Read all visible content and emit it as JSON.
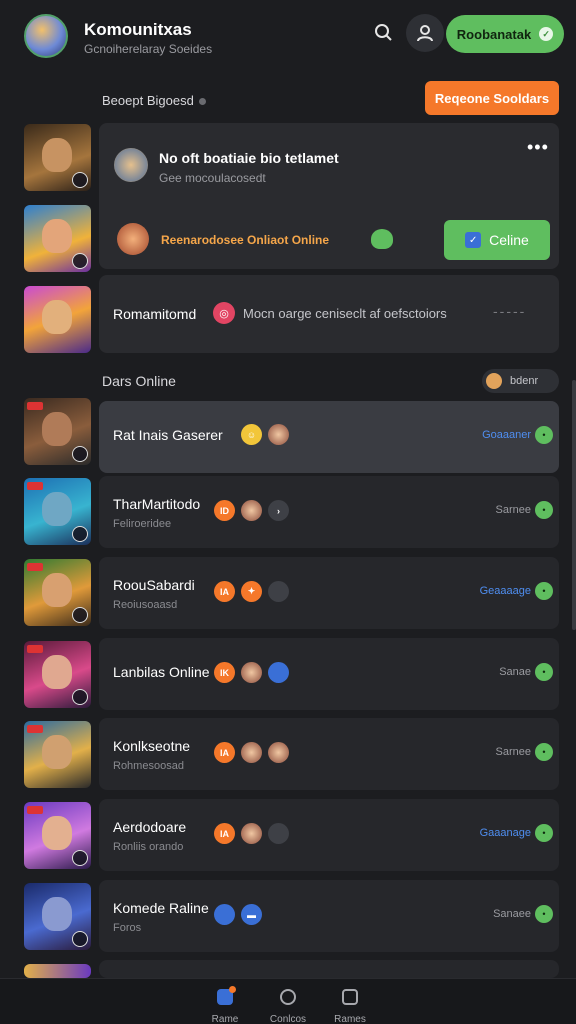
{
  "header": {
    "title": "Komounitxas",
    "subtitle": "Gcnoiherelaray Soeides",
    "cta_label": "Roobanatak"
  },
  "section1": {
    "label": "Beoept Bigoesd",
    "button_label": "Reqeone Sooldars"
  },
  "featured": {
    "title": "No oft boatiaie bio tetlamet",
    "subtitle": "Gee mocoulacosedt",
    "row_text": "Reenarodosee Onliaot Online",
    "online_button": "Celine"
  },
  "recommend": {
    "title": "Romamitomd",
    "text": "Mocn oarge ceniseclt af oefsctoiors",
    "dashes": "-----"
  },
  "section2": {
    "label": "Dars Online",
    "pill_label": "bdenr"
  },
  "rows": [
    {
      "name": "Rat Inais Gaserer",
      "sub": "",
      "badge": "",
      "status": "Goaaaner"
    },
    {
      "name": "TharMartitodo",
      "sub": "Feliroeridee",
      "badge": "ID",
      "status": "Sarnee"
    },
    {
      "name": "RoouSabardi",
      "sub": "Reoiusoaasd",
      "badge": "IA",
      "status": "Geaaaage"
    },
    {
      "name": "Lanbilas Online",
      "sub": "",
      "badge": "IK",
      "status": "Sanae"
    },
    {
      "name": "Konlkseotne",
      "sub": "Rohmesoosad",
      "badge": "IA",
      "status": "Sarnee"
    },
    {
      "name": "Aerdodoare",
      "sub": "Ronliis orando",
      "badge": "IA",
      "status": "Gaaanage"
    },
    {
      "name": "Komede Raline",
      "sub": "Foros",
      "badge": "",
      "status": "Sanaee"
    }
  ],
  "nav": {
    "home": "Rame",
    "middle": "Conlcos",
    "right": "Rames"
  },
  "colors": {
    "accent_green": "#5fbe5f",
    "accent_orange": "#f5782a",
    "status_blue": "#4f8ef0",
    "background": "#1c1d20"
  }
}
